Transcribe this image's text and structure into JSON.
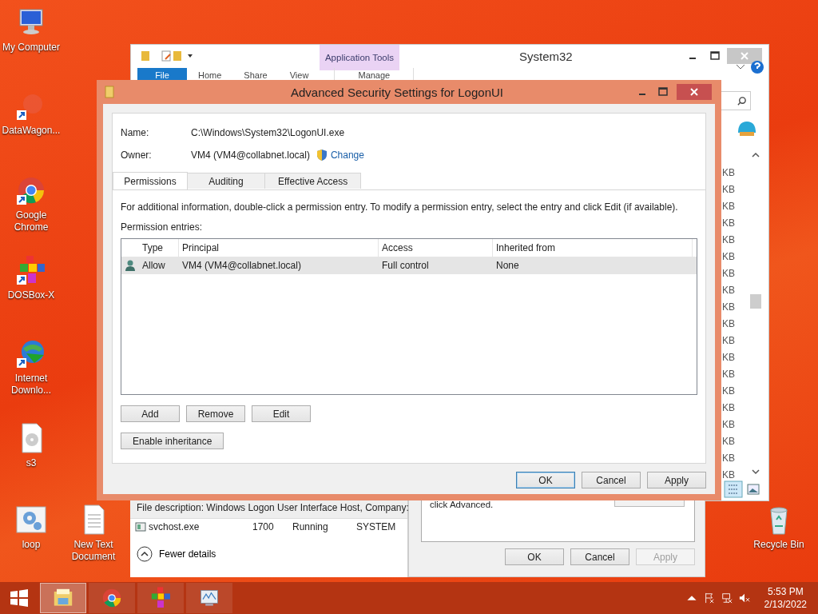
{
  "desktop_icons": [
    {
      "label": "My Computer",
      "kind": "computer",
      "shortcut": false
    },
    {
      "label": "DataWagon...",
      "kind": "faint",
      "shortcut": true
    },
    {
      "label": "Google Chrome",
      "kind": "chrome",
      "shortcut": true
    },
    {
      "label": "DOSBox-X",
      "kind": "dosbox",
      "shortcut": true
    },
    {
      "label": "Internet Downlo...",
      "kind": "globe",
      "shortcut": true
    },
    {
      "label": "s3",
      "kind": "disc-file",
      "shortcut": false
    },
    {
      "label": "loop",
      "kind": "gear",
      "shortcut": false
    },
    {
      "label": "New Text Document",
      "kind": "text-file",
      "shortcut": false
    },
    {
      "label": "Recycle Bin",
      "kind": "recycle",
      "shortcut": false
    }
  ],
  "explorer": {
    "title": "System32",
    "context_label": "Application Tools",
    "ribbon_tabs": [
      {
        "label": "File",
        "kind": "file",
        "selected": true
      },
      {
        "label": "Home",
        "kind": "standard",
        "selected": false
      },
      {
        "label": "Share",
        "kind": "standard",
        "selected": false
      },
      {
        "label": "View",
        "kind": "standard",
        "selected": false
      },
      {
        "label": "Manage",
        "kind": "contextual",
        "selected": false
      }
    ],
    "sizes": [
      "KB",
      "KB",
      "KB",
      "KB",
      "KB",
      "KB",
      "KB",
      "KB",
      "KB",
      "KB",
      "KB",
      "KB",
      "KB",
      "KB",
      "KB",
      "KB",
      "KB",
      "KB",
      "KB"
    ]
  },
  "task_manager": {
    "description": "File description: Windows Logon User Interface Host, Company:",
    "process": {
      "name": "svchost.exe",
      "pid": "1700",
      "status": "Running",
      "user": "SYSTEM"
    },
    "toggle": "Fewer details"
  },
  "properties": {
    "text": "click Advanced.",
    "buttons": [
      {
        "label": "OK",
        "disabled": false
      },
      {
        "label": "Cancel",
        "disabled": false
      },
      {
        "label": "Apply",
        "disabled": true
      }
    ]
  },
  "dialog": {
    "title": "Advanced Security Settings for LogonUI",
    "name_label": "Name:",
    "name_value": "C:\\Windows\\System32\\LogonUI.exe",
    "owner_label": "Owner:",
    "owner_value": "VM4 (VM4@collabnet.local)",
    "change_link": "Change",
    "tabs": [
      {
        "label": "Permissions",
        "selected": true
      },
      {
        "label": "Auditing",
        "selected": false
      },
      {
        "label": "Effective Access",
        "selected": false
      }
    ],
    "info": "For additional information, double-click a permission entry. To modify a permission entry, select the entry and click Edit (if available).",
    "entries_label": "Permission entries:",
    "columns": [
      "Type",
      "Principal",
      "Access",
      "Inherited from"
    ],
    "rows": [
      {
        "type": "Allow",
        "principal": "VM4 (VM4@collabnet.local)",
        "access": "Full control",
        "inherited": "None",
        "selected": true
      }
    ],
    "entry_buttons": [
      "Add",
      "Remove",
      "Edit"
    ],
    "inheritance_button": "Enable inheritance",
    "footer_buttons": [
      {
        "label": "OK",
        "default": true
      },
      {
        "label": "Cancel",
        "default": false
      },
      {
        "label": "Apply",
        "default": false
      }
    ]
  },
  "taskbar": {
    "apps": [
      {
        "kind": "explorer",
        "selected": true
      },
      {
        "kind": "chrome",
        "selected": false
      },
      {
        "kind": "dosbox",
        "selected": false
      },
      {
        "kind": "monitor",
        "selected": false
      }
    ],
    "time": "5:53 PM",
    "date": "2/13/2022"
  }
}
